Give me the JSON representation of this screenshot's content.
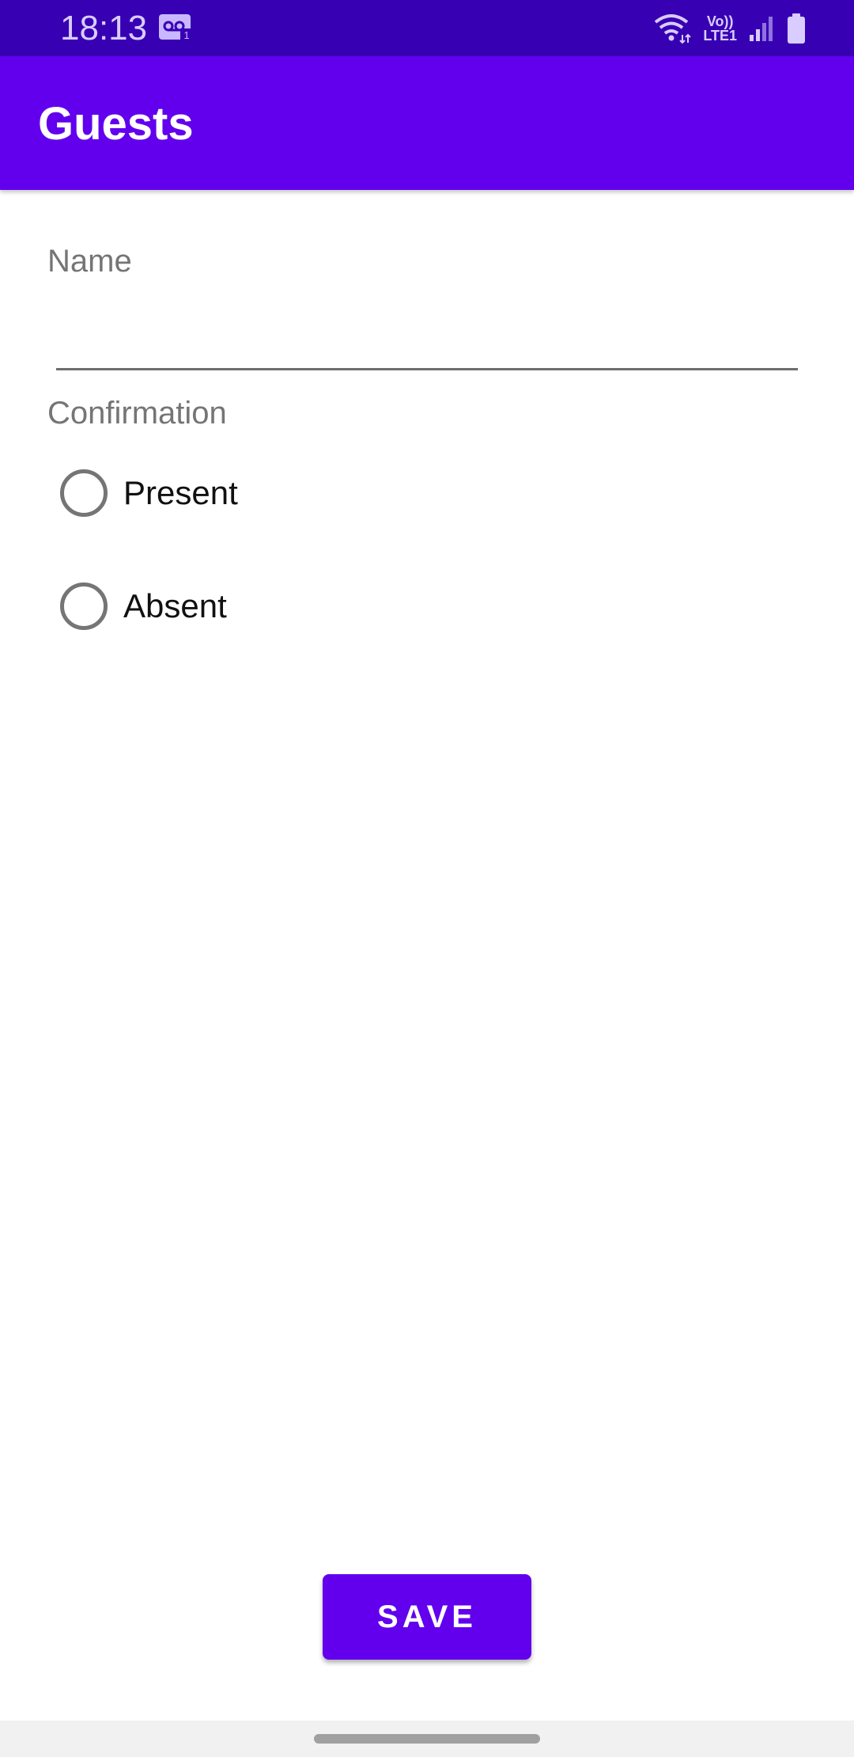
{
  "status_bar": {
    "time": "18:13",
    "network_label": "Vo))\nLTE1",
    "icons": [
      "voicemail-icon",
      "wifi-icon",
      "lte-icon",
      "signal-icon",
      "battery-icon"
    ]
  },
  "app_bar": {
    "title": "Guests",
    "color": "#6200ee"
  },
  "form": {
    "name_label": "Name",
    "name_value": "",
    "confirmation_label": "Confirmation",
    "options": [
      {
        "label": "Present",
        "selected": false
      },
      {
        "label": "Absent",
        "selected": false
      }
    ]
  },
  "actions": {
    "save_label": "SAVE"
  },
  "colors": {
    "status_bar": "#3700b3",
    "primary": "#6200ee",
    "label_gray": "#757575"
  }
}
